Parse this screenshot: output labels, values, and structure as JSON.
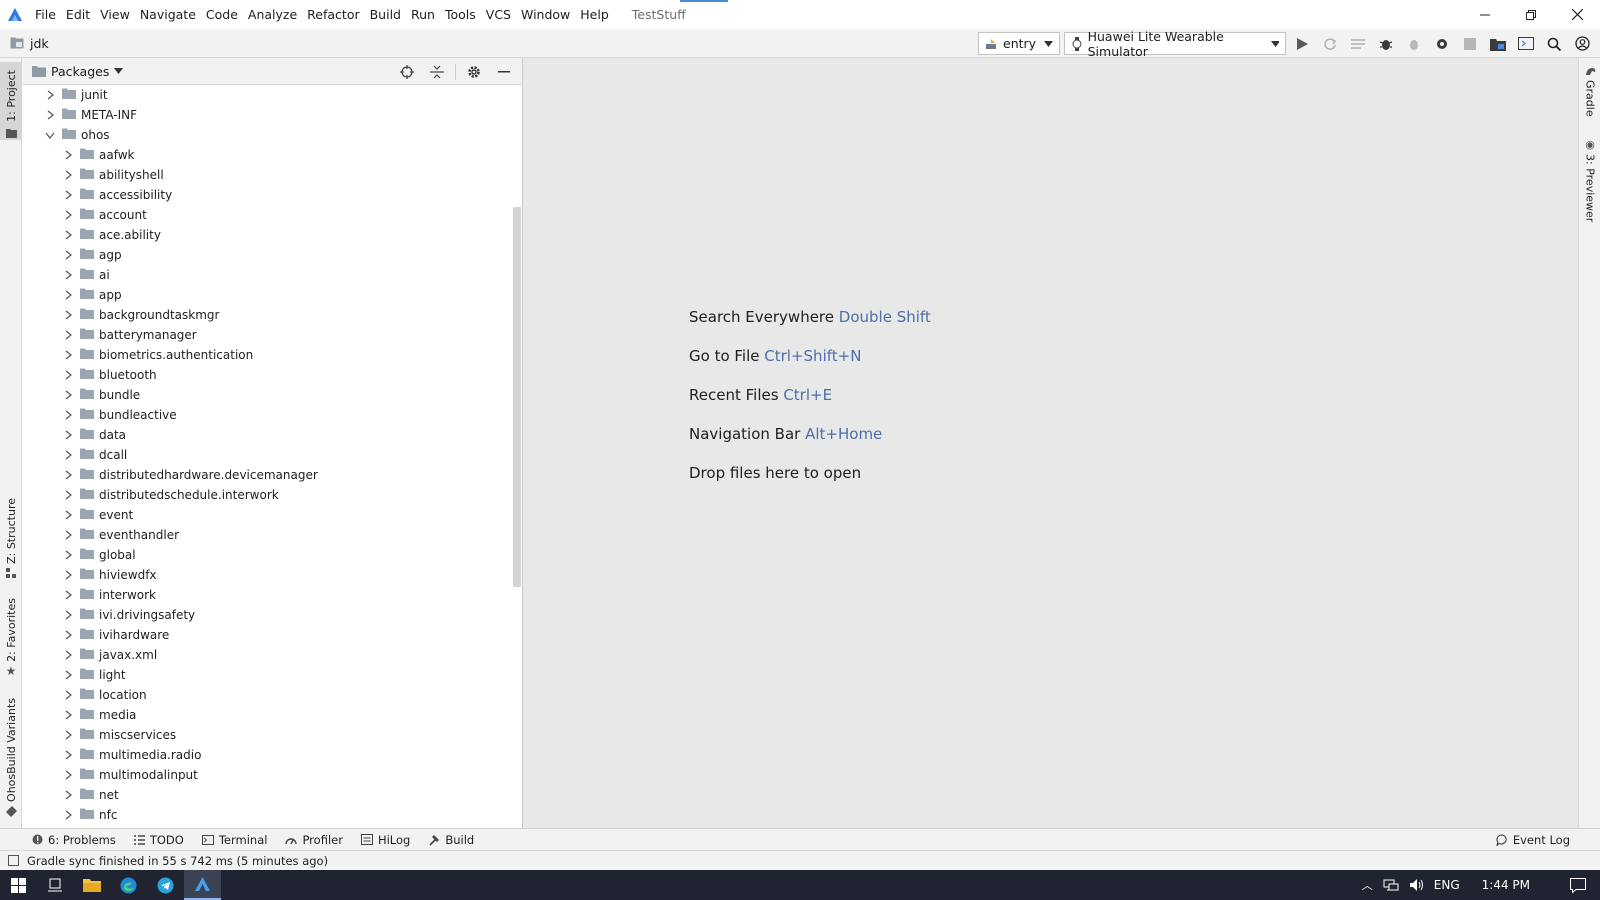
{
  "titlebar": {
    "menu": [
      "File",
      "Edit",
      "View",
      "Navigate",
      "Code",
      "Analyze",
      "Refactor",
      "Build",
      "Run",
      "Tools",
      "VCS",
      "Window",
      "Help"
    ],
    "project_name": "TestStuff"
  },
  "navbar": {
    "breadcrumb": "jdk",
    "run_config": "entry",
    "device": "Huawei Lite Wearable Simulator"
  },
  "left_tabs": {
    "project": "1: Project",
    "structure": "Z: Structure",
    "favorites": "2: Favorites",
    "build_variants": "OhosBuild Variants"
  },
  "right_tabs": {
    "gradle": "Gradle",
    "previewer": "3: Previewer"
  },
  "project_panel": {
    "view_mode": "Packages",
    "top_nodes": [
      {
        "label": "junit",
        "expanded": false
      },
      {
        "label": "META-INF",
        "expanded": false
      },
      {
        "label": "ohos",
        "expanded": true
      }
    ],
    "ohos_children": [
      "aafwk",
      "abilityshell",
      "accessibility",
      "account",
      "ace.ability",
      "agp",
      "ai",
      "app",
      "backgroundtaskmgr",
      "batterymanager",
      "biometrics.authentication",
      "bluetooth",
      "bundle",
      "bundleactive",
      "data",
      "dcall",
      "distributedhardware.devicemanager",
      "distributedschedule.interwork",
      "event",
      "eventhandler",
      "global",
      "hiviewdfx",
      "interwork",
      "ivi.drivingsafety",
      "ivihardware",
      "javax.xml",
      "light",
      "location",
      "media",
      "miscservices",
      "multimedia.radio",
      "multimodalinput",
      "net",
      "nfc"
    ]
  },
  "editor": {
    "hints": [
      {
        "text": "Search Everywhere",
        "key": "Double Shift"
      },
      {
        "text": "Go to File",
        "key": "Ctrl+Shift+N"
      },
      {
        "text": "Recent Files",
        "key": "Ctrl+E"
      },
      {
        "text": "Navigation Bar",
        "key": "Alt+Home"
      },
      {
        "text": "Drop files here to open",
        "key": ""
      }
    ]
  },
  "tool_tabs": {
    "problems": "6: Problems",
    "todo": "TODO",
    "terminal": "Terminal",
    "profiler": "Profiler",
    "hilog": "HiLog",
    "build": "Build",
    "event_log": "Event Log"
  },
  "status": {
    "message": "Gradle sync finished in 55 s 742 ms (5 minutes ago)"
  },
  "taskbar": {
    "language": "ENG",
    "time": "1:44 PM"
  },
  "colors": {
    "shortcut_key": "#4c6fa8",
    "taskbar_bg": "#1f2430",
    "editor_bg": "#e8e8e8"
  }
}
